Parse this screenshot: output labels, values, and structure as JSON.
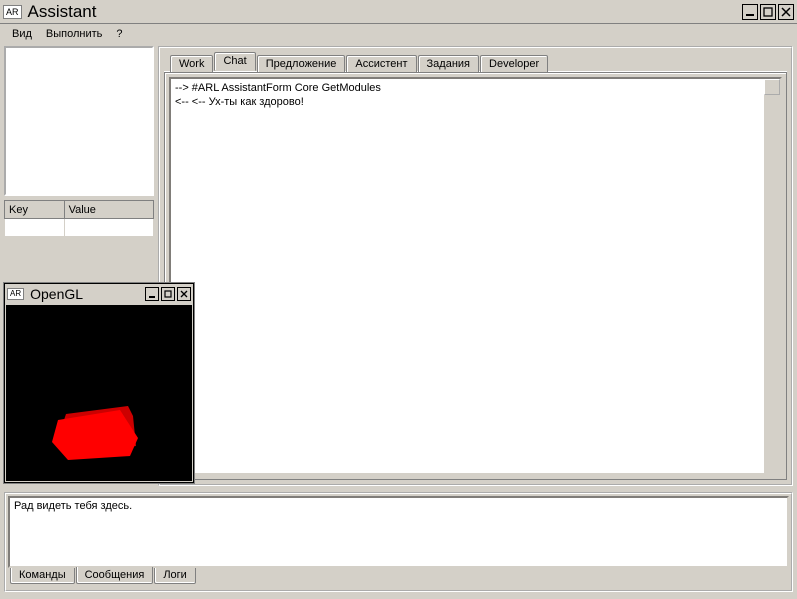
{
  "window": {
    "app_icon_text": "AR",
    "title": "Assistant"
  },
  "menu": {
    "view": "Вид",
    "execute": "Выполнить",
    "help": "?"
  },
  "sidebar": {
    "table": {
      "key_header": "Key",
      "value_header": "Value"
    }
  },
  "tabs": {
    "work": "Work",
    "chat": "Chat",
    "proposal": "Предложение",
    "assistant": "Ассистент",
    "tasks": "Задания",
    "developer": "Developer"
  },
  "chat": {
    "line1": "--> #ARL AssistantForm Core GetModules",
    "line2": "<-- <-- Ух-ты как здорово!"
  },
  "bottom": {
    "message": "Рад видеть тебя здесь."
  },
  "bottom_tabs": {
    "commands": "Команды",
    "messages": "Сообщения",
    "logs": "Логи"
  },
  "float": {
    "app_icon_text": "AR",
    "title": "OpenGL"
  }
}
